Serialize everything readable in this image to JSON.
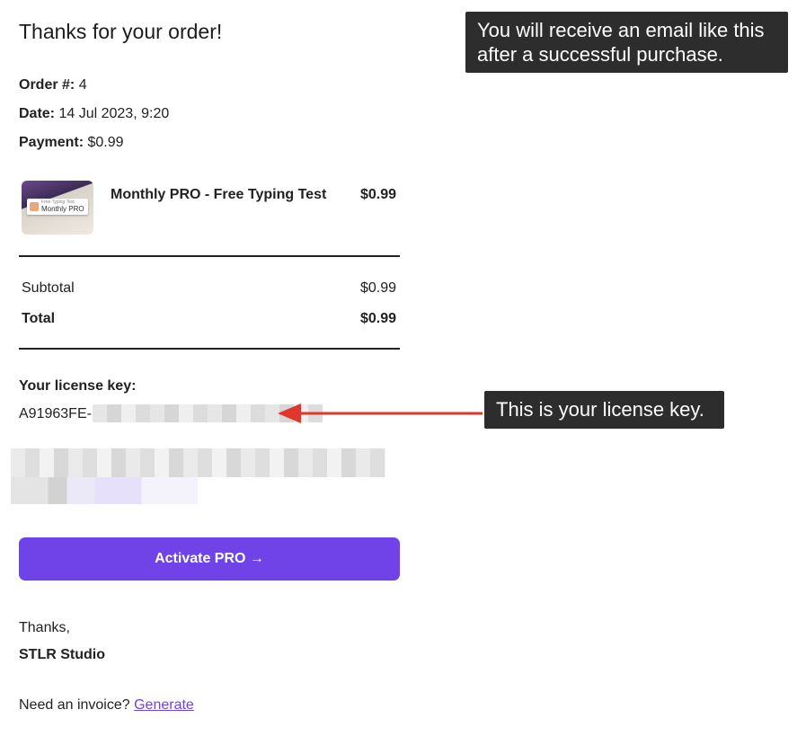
{
  "email": {
    "heading": "Thanks for your order!",
    "order_label": "Order #:",
    "order_value": "4",
    "date_label": "Date:",
    "date_value": "14 Jul 2023, 9:20",
    "payment_label": "Payment:",
    "payment_value": "$0.99"
  },
  "item": {
    "thumb_text_small": "Free Typing Test",
    "thumb_text_main": "Monthly PRO",
    "name": "Monthly PRO - Free Typing Test",
    "price": "$0.99"
  },
  "totals": {
    "subtotal_label": "Subtotal",
    "subtotal_value": "$0.99",
    "total_label": "Total",
    "total_value": "$0.99"
  },
  "license": {
    "label": "Your license key:",
    "prefix": "A91963FE-"
  },
  "cta": {
    "label": "Activate PRO →"
  },
  "signature": {
    "thanks": "Thanks,",
    "company": "STLR Studio"
  },
  "invoice": {
    "prompt": "Need an invoice?",
    "link": "Generate"
  },
  "annotations": {
    "top_callout": "You will receive an email like this after a successful purchase.",
    "key_callout": "This is your license key.",
    "arrow_color": "#e0362c"
  },
  "colors": {
    "accent": "#6f43e8",
    "callout_bg": "#2d2d2d"
  }
}
